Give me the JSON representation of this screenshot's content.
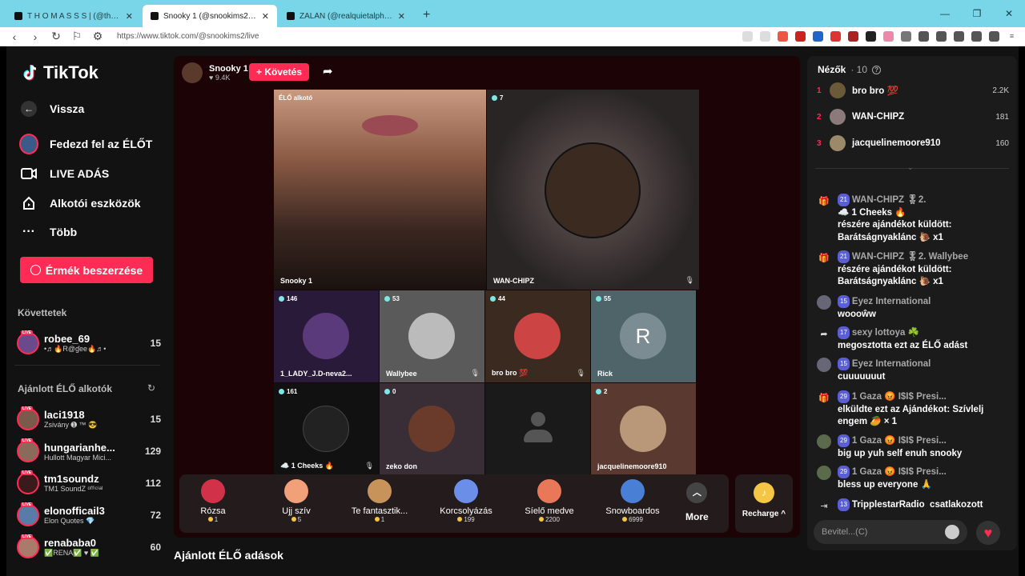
{
  "browser": {
    "tabs": [
      {
        "title": "T H O M A S S S | (@thomass"
      },
      {
        "title": "Snooky 1 (@snookims2) ÉLŐ"
      },
      {
        "title": "ZALÁN (@realquietalpha) ÉLŐ"
      }
    ],
    "url": "https://www.tiktok.com/@snookims2/live"
  },
  "sidebar": {
    "brand": "TikTok",
    "back": "Vissza",
    "nav": [
      {
        "label": "Fedezd fel az ÉLŐT",
        "icon": "live-avatar-icon"
      },
      {
        "label": "LIVE ADÁS",
        "icon": "camera-icon"
      },
      {
        "label": "Alkotói eszközök",
        "icon": "creator-tools-icon"
      },
      {
        "label": "Több",
        "icon": "more-icon"
      }
    ],
    "coins_button": "Érmék beszerzése",
    "followed_title": "Követtetek",
    "followed": [
      {
        "name": "robee_69",
        "sub": "•♬🔥R@ɠee🔥♬•",
        "count": "15"
      }
    ],
    "recommended_title": "Ajánlott ÉLŐ alkotók",
    "recommended": [
      {
        "name": "laci1918",
        "sub": "Zsivány ➊ ™ 😎",
        "count": "15"
      },
      {
        "name": "hungarianhe...",
        "sub": "Hullott Magyar Mici...",
        "count": "129"
      },
      {
        "name": "tm1soundz",
        "sub": "TM1 SoundZ ᵒᶠᶠⁱᶜⁱᵃˡ",
        "count": "112"
      },
      {
        "name": "elonofficail3",
        "sub": "Elon Quotes 💎",
        "count": "72"
      },
      {
        "name": "renababa0",
        "sub": "✅RENA✅ ♥ ✅",
        "count": "60"
      }
    ]
  },
  "stage": {
    "host_name": "Snooky 1",
    "host_likes": "♥ 9.4K",
    "follow_label": "+ Követés",
    "main_label": "ÉLŐ alkotó",
    "cells": [
      {
        "name": "Snooky 1",
        "badge": ""
      },
      {
        "name": "WAN-CHIPZ",
        "badge": "7"
      },
      {
        "name": "1_LADY_J.D-neva2...",
        "badge": "146"
      },
      {
        "name": "Wallybee",
        "badge": "53"
      },
      {
        "name": "bro bro 💯",
        "badge": "44"
      },
      {
        "name": "Rick",
        "badge": "55",
        "initial": "R"
      },
      {
        "name": "☁️ 1 Cheeks 🔥",
        "badge": "161"
      },
      {
        "name": "zeko don",
        "badge": "0"
      },
      {
        "name": "",
        "badge": ""
      },
      {
        "name": "jacquelinemoore910",
        "badge": "2"
      }
    ]
  },
  "gifts": [
    {
      "name": "Rózsa",
      "price": "1",
      "color": "#d2314a"
    },
    {
      "name": "Ujj szív",
      "price": "5",
      "color": "#f1a07a"
    },
    {
      "name": "Te fantasztik...",
      "price": "1",
      "color": "#c8935a"
    },
    {
      "name": "Korcsolyázás",
      "price": "199",
      "color": "#6b8fe8"
    },
    {
      "name": "Síelő medve",
      "price": "2200",
      "color": "#e87858"
    },
    {
      "name": "Snowboardos",
      "price": "6999",
      "color": "#4a7fd6"
    }
  ],
  "more_label": "More",
  "recharge_label": "Recharge ^",
  "below_title": "Ajánlott ÉLŐ adások",
  "panel": {
    "viewers_title": "Nézők",
    "viewers_count": "· 10",
    "top_viewers": [
      {
        "rank": "1",
        "name": "bro bro 💯",
        "count": "2.2K"
      },
      {
        "rank": "2",
        "name": "WAN-CHIPZ",
        "count": "181"
      },
      {
        "rank": "3",
        "name": "jacquelinemoore910",
        "count": "160"
      }
    ],
    "messages": [
      {
        "icon": "gift-icon",
        "lvl": "21",
        "hrt": "",
        "user": "WAN-CHIPZ",
        "extra": "🎖2.",
        "line2": "☁️ 1 Cheeks 🔥",
        "body": "részére ajándékot küldött: Barátságnyaklánc 🐌 x1"
      },
      {
        "icon": "gift-icon",
        "lvl": "21",
        "hrt": "",
        "user": "WAN-CHIPZ",
        "extra": "🎖2. Wallybee",
        "line2": "",
        "body": "részére ajándékot küldött: Barátságnyaklánc 🐌 x1"
      },
      {
        "icon": "avatar",
        "lvl": "15",
        "hrt": "",
        "user": "Eyez International",
        "extra": "",
        "line2": "",
        "body": "woooŵw"
      },
      {
        "icon": "share-icon",
        "lvl": "17",
        "hrt": "",
        "user": "sexy lottoya ☘️",
        "extra": "",
        "line2": "",
        "body": "megosztotta ezt az ÉLŐ adást"
      },
      {
        "icon": "avatar",
        "lvl": "15",
        "hrt": "",
        "user": "Eyez International",
        "extra": "",
        "line2": "",
        "body": "cuuuuuuut"
      },
      {
        "icon": "gift-icon",
        "lvl": "29",
        "hrt": "",
        "user": "1 Gaza 😡 I$I$ Presi...",
        "extra": "",
        "line2": "",
        "body": "elküldte ezt az Ajándékot: Szívlelj engem 🥭 × 1"
      },
      {
        "icon": "avatar",
        "lvl": "29",
        "hrt": "",
        "user": "1 Gaza 😡 I$I$ Presi...",
        "extra": "",
        "line2": "",
        "body": "big up yuh self enuh snooky"
      },
      {
        "icon": "avatar",
        "lvl": "29",
        "hrt": "",
        "user": "1 Gaza 😡 I$I$ Presi...",
        "extra": "",
        "line2": "",
        "body": "bless up everyone 🙏"
      },
      {
        "icon": "join-icon",
        "lvl": "13",
        "hrt": "",
        "user": "TripplestarRadio",
        "extra": "",
        "line2": "",
        "body": "csatlakozott"
      }
    ],
    "input_placeholder": "Bevitel...(C)"
  }
}
